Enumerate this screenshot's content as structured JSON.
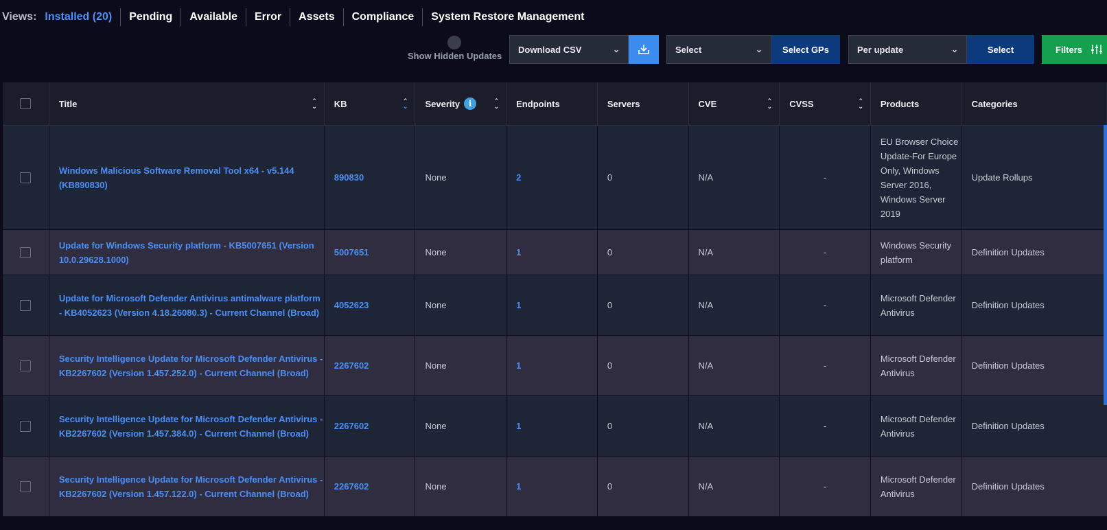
{
  "views": {
    "label": "Views:",
    "tabs": [
      {
        "label": "Installed (20)",
        "active": true
      },
      {
        "label": "Pending"
      },
      {
        "label": "Available"
      },
      {
        "label": "Error"
      },
      {
        "label": "Assets"
      },
      {
        "label": "Compliance"
      },
      {
        "label": "System Restore Management"
      }
    ]
  },
  "toolbar": {
    "show_hidden_label": "Show Hidden Updates",
    "download_label": "Download CSV",
    "group_select_label": "Select",
    "select_gps_label": "Select GPs",
    "per_update_label": "Per update",
    "select_label": "Select",
    "filters_label": "Filters"
  },
  "table": {
    "headers": {
      "title": "Title",
      "kb": "KB",
      "severity": "Severity",
      "endpoints": "Endpoints",
      "servers": "Servers",
      "cve": "CVE",
      "cvss": "CVSS",
      "products": "Products",
      "categories": "Categories"
    },
    "rows": [
      {
        "title": "Windows Malicious Software Removal Tool x64 - v5.144 (KB890830)",
        "kb": "890830",
        "severity": "None",
        "endpoints": "2",
        "servers": "0",
        "cve": "N/A",
        "cvss": "-",
        "products": "EU Browser Choice Update-For Europe Only, Windows Server 2016, Windows Server 2019",
        "categories": "Update Rollups"
      },
      {
        "title": "Update for Windows Security platform - KB5007651 (Version 10.0.29628.1000)",
        "kb": "5007651",
        "severity": "None",
        "endpoints": "1",
        "servers": "0",
        "cve": "N/A",
        "cvss": "-",
        "products": "Windows Security platform",
        "categories": "Definition Updates"
      },
      {
        "title": "Update for Microsoft Defender Antivirus antimalware platform - KB4052623 (Version 4.18.26080.3) - Current Channel (Broad)",
        "kb": "4052623",
        "severity": "None",
        "endpoints": "1",
        "servers": "0",
        "cve": "N/A",
        "cvss": "-",
        "products": "Microsoft Defender Antivirus",
        "categories": "Definition Updates"
      },
      {
        "title": "Security Intelligence Update for Microsoft Defender Antivirus - KB2267602 (Version 1.457.252.0) - Current Channel (Broad)",
        "kb": "2267602",
        "severity": "None",
        "endpoints": "1",
        "servers": "0",
        "cve": "N/A",
        "cvss": "-",
        "products": "Microsoft Defender Antivirus",
        "categories": "Definition Updates"
      },
      {
        "title": "Security Intelligence Update for Microsoft Defender Antivirus - KB2267602 (Version 1.457.384.0) - Current Channel (Broad)",
        "kb": "2267602",
        "severity": "None",
        "endpoints": "1",
        "servers": "0",
        "cve": "N/A",
        "cvss": "-",
        "products": "Microsoft Defender Antivirus",
        "categories": "Definition Updates"
      },
      {
        "title": "Security Intelligence Update for Microsoft Defender Antivirus - KB2267602 (Version 1.457.122.0) - Current Channel (Broad)",
        "kb": "2267602",
        "severity": "None",
        "endpoints": "1",
        "servers": "0",
        "cve": "N/A",
        "cvss": "-",
        "products": "Microsoft Defender Antivirus",
        "categories": "Definition Updates"
      }
    ]
  }
}
